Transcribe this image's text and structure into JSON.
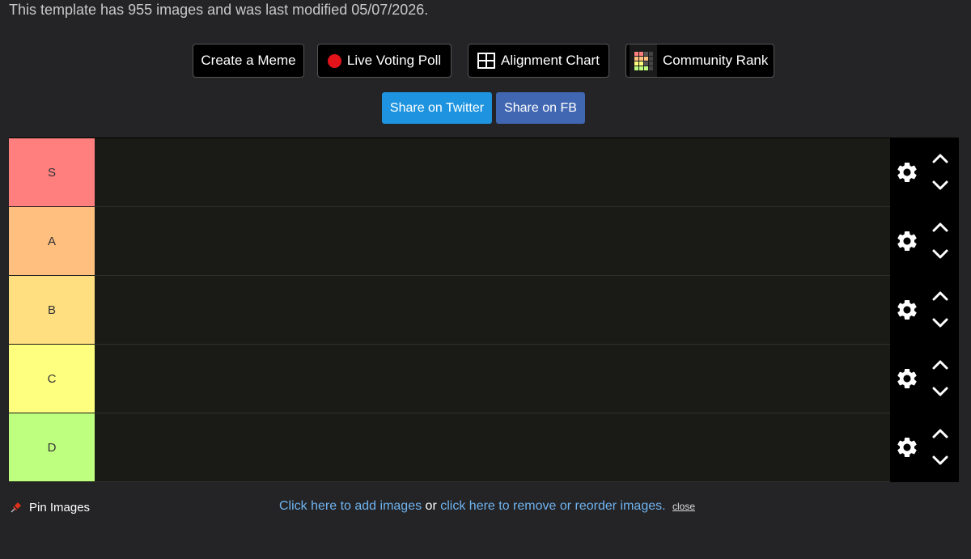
{
  "info_text": "This template has 955 images and was last modified 05/07/2026.",
  "buttons": {
    "create_meme": "Create a Meme",
    "live_voting": "Live Voting Poll",
    "alignment_chart": "Alignment Chart",
    "community_rank": "Community Rank"
  },
  "share": {
    "twitter": "Share on Twitter",
    "facebook": "Share on FB",
    "twitter_color": "#1e94e0",
    "facebook_color": "#4267b2"
  },
  "tiers": [
    {
      "label": "S",
      "color": "#ff7f7f"
    },
    {
      "label": "A",
      "color": "#ffbf7f"
    },
    {
      "label": "B",
      "color": "#ffdf7f"
    },
    {
      "label": "C",
      "color": "#ffff7f"
    },
    {
      "label": "D",
      "color": "#bfff7f"
    }
  ],
  "pin_images": "Pin Images",
  "footer": {
    "add_link": "Click here to add images",
    "or": "or",
    "remove_link": "click here to remove or reorder images.",
    "close": "close"
  },
  "icons": {
    "tier_settings": "gear-icon",
    "move_up": "chevron-up-icon",
    "move_down": "chevron-down-icon",
    "pin": "pushpin-icon",
    "live": "red-dot-icon",
    "alignment": "grid-icon",
    "community_rank": "rank-grid-icon"
  }
}
